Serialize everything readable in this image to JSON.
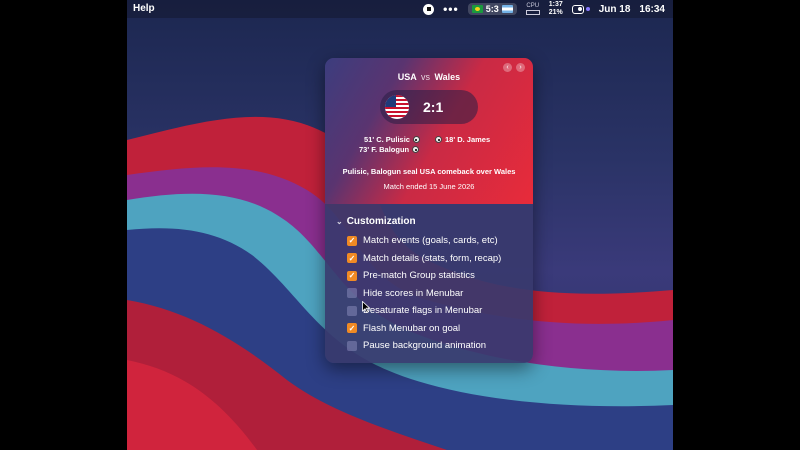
{
  "menubar": {
    "app_menu": "Help",
    "score_pill": "5:3",
    "cpu_label": "CPU",
    "battery_time": "1:37",
    "battery_pct": "21%",
    "date": "Jun 18",
    "time": "16:34"
  },
  "popover": {
    "home_team": "USA",
    "vs": "vs",
    "away_team": "Wales",
    "score": "2:1",
    "events": {
      "home_1": "51' C. Pulisic",
      "home_2": "73' F. Balogun",
      "away_1": "18' D. James"
    },
    "headline": "Pulisic, Balogun seal USA comeback over Wales",
    "status": "Match ended 15 June 2026",
    "customization": {
      "title": "Customization",
      "options": [
        {
          "label": "Match events (goals, cards, etc)",
          "checked": true
        },
        {
          "label": "Match details (stats, form, recap)",
          "checked": true
        },
        {
          "label": "Pre-match Group statistics",
          "checked": true
        },
        {
          "label": "Hide scores in Menubar",
          "checked": false
        },
        {
          "label": "Desaturate flags in Menubar",
          "checked": false
        },
        {
          "label": "Flash Menubar on goal",
          "checked": true
        },
        {
          "label": "Pause background animation",
          "checked": false
        }
      ]
    }
  },
  "colors": {
    "accent": "#f08a24",
    "hero_red": "#e82b3a"
  }
}
